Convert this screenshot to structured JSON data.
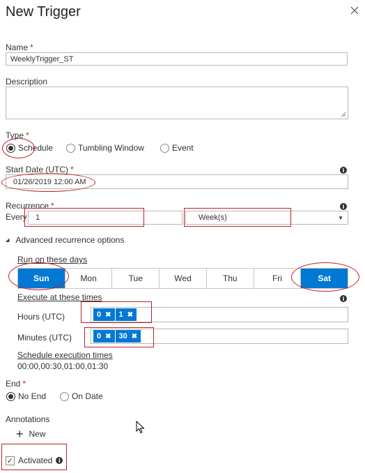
{
  "dialog": {
    "title": "New Trigger"
  },
  "name": {
    "label": "Name",
    "required": "*",
    "value": "WeeklyTrigger_ST"
  },
  "description": {
    "label": "Description",
    "value": ""
  },
  "type": {
    "label": "Type",
    "required": "*",
    "options": [
      "Schedule",
      "Tumbling Window",
      "Event"
    ],
    "selected": "Schedule"
  },
  "start_date": {
    "label": "Start Date (UTC)",
    "required": "*",
    "value": "01/26/2019 12:00 AM"
  },
  "recurrence": {
    "label": "Recurrence",
    "required": "*",
    "every_label": "Every",
    "interval": "1",
    "unit": "Week(s)"
  },
  "advanced": {
    "toggle_label": "Advanced recurrence options",
    "run_days_label": "Run on these days",
    "days": [
      "Sun",
      "Mon",
      "Tue",
      "Wed",
      "Thu",
      "Fri",
      "Sat"
    ],
    "selected_days": [
      "Sun",
      "Sat"
    ],
    "execute_label": "Execute at these times",
    "hours_label": "Hours (UTC)",
    "hours": [
      "0",
      "1"
    ],
    "minutes_label": "Minutes (UTC)",
    "minutes": [
      "0",
      "30"
    ],
    "schedule_label": "Schedule execution times",
    "schedule_value": "00:00,00:30,01:00,01:30"
  },
  "end": {
    "label": "End",
    "required": "*",
    "options": [
      "No End",
      "On Date"
    ],
    "selected": "No End"
  },
  "annotations": {
    "label": "Annotations",
    "new_label": "New"
  },
  "activated": {
    "label": "Activated",
    "checked": true
  },
  "colors": {
    "accent": "#0078d4",
    "highlight": "#c0202a"
  }
}
